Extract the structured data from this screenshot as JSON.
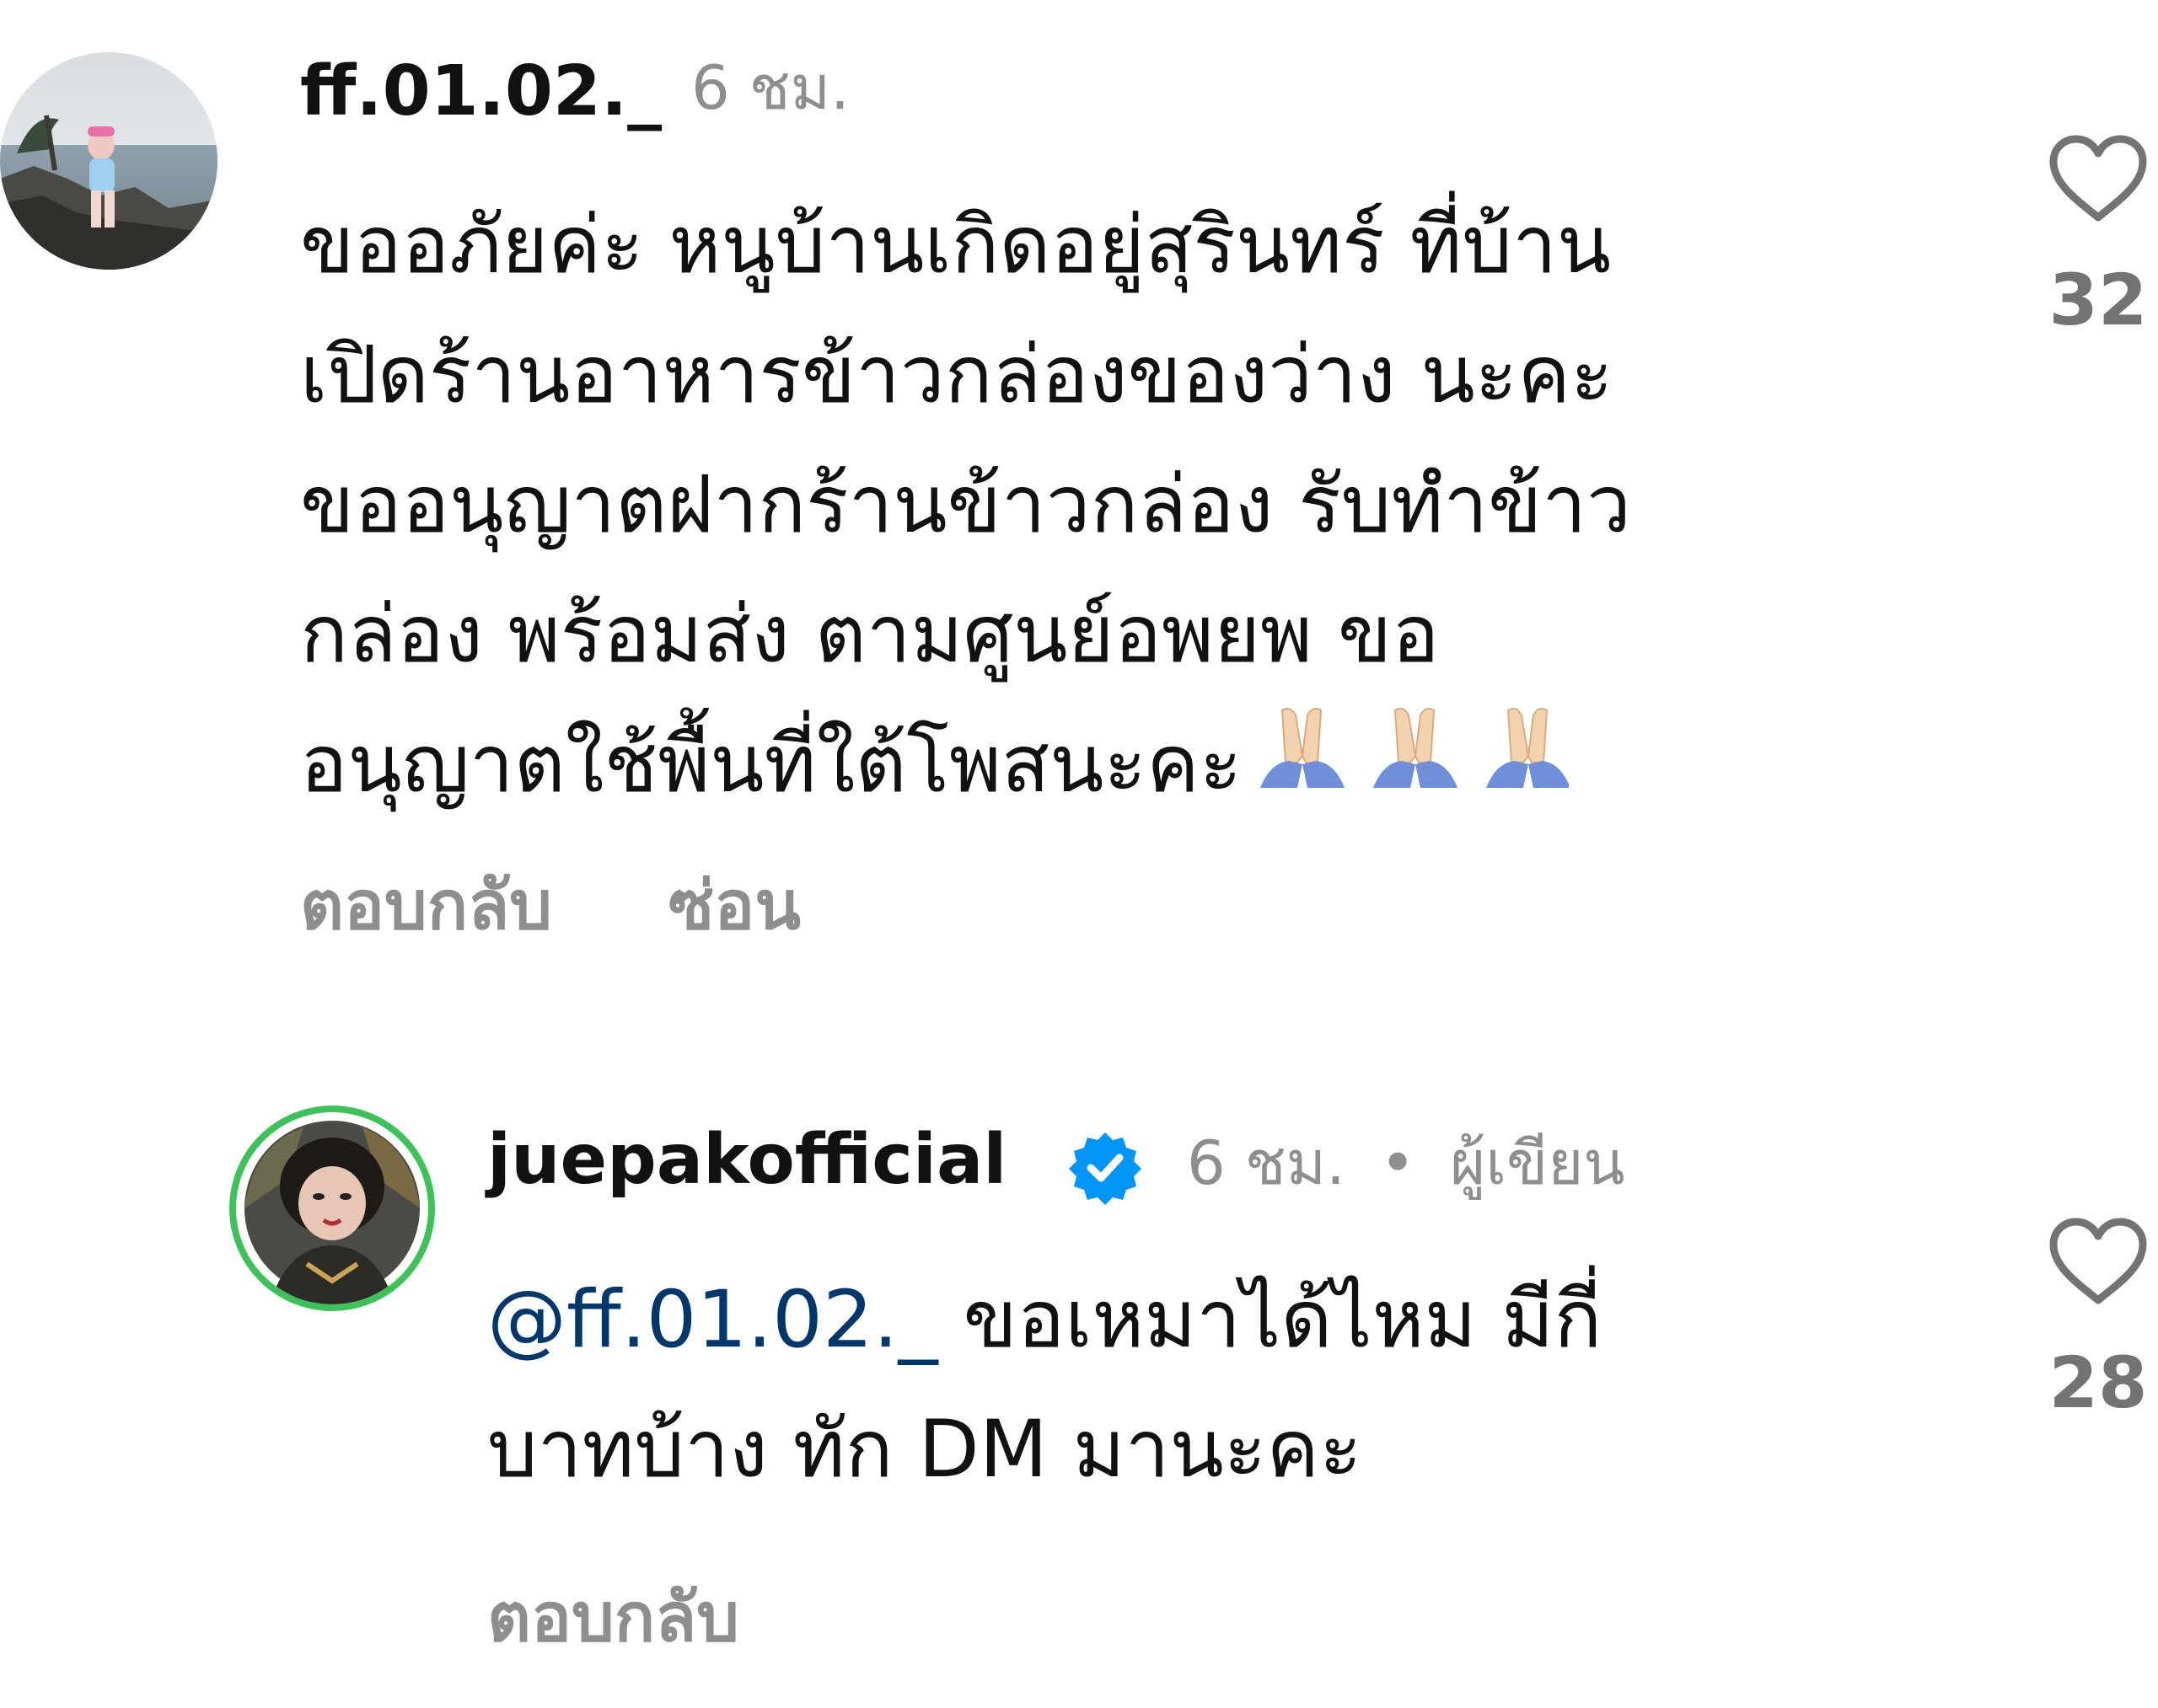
{
  "colors": {
    "meta_gray": "#8e8e8e",
    "mention_blue": "#00376b",
    "verified_blue": "#0095f6",
    "story_ring_green": "#3ec15a"
  },
  "comments": [
    {
      "username": "ff.01.02._",
      "time": "6 ชม.",
      "text_lines": [
        "ขออภัยค่ะ หนูบ้านเกิดอยู่สุรินทร์ ที่บ้าน",
        "เปิดร้านอาหารข้าวกล่องของว่าง นะคะ",
        "ขออนุญาตฝากร้านข้าวกล่อง  รับทำข้าว",
        "กล่อง  พร้อมส่ง ตามศูนย์อพยพ ขอ",
        "อนุญาตใช้พื้นที่ใต้โพสนะคะ"
      ],
      "emoji_icon": "folded-hands-icon",
      "reply_label": "ตอบกลับ",
      "hide_label": "ซ่อน",
      "likes": "32"
    },
    {
      "username": "juepakofficial",
      "verified_icon": "verified-badge-icon",
      "time": "6 ชม.",
      "separator": "•",
      "author_label": "ผู้เขียน",
      "mention": "@ff.01.02._",
      "text_line1_rest": " ขอเหมาได้ไหม มีกี่",
      "text_line2": "บาทบ้าง ทัก DM มานะคะ",
      "reply_label": "ตอบกลับ",
      "likes": "28"
    }
  ]
}
